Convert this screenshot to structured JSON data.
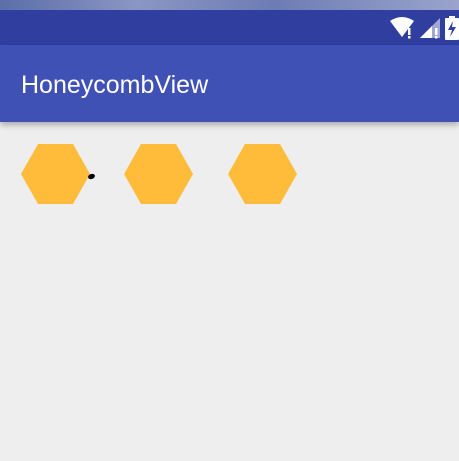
{
  "app_bar": {
    "title": "HoneycombView"
  },
  "colors": {
    "status_bar": "#303f9f",
    "app_bar": "#3f51b5",
    "hexagon": "#ffbc3b",
    "background": "#eeeeee"
  },
  "status_bar": {
    "icons": [
      "wifi-icon",
      "signal-icon",
      "battery-charging-icon"
    ]
  },
  "honeycomb": {
    "cells": [
      {
        "name": "hexagon-cell-1"
      },
      {
        "name": "hexagon-cell-2"
      },
      {
        "name": "hexagon-cell-3"
      }
    ]
  }
}
